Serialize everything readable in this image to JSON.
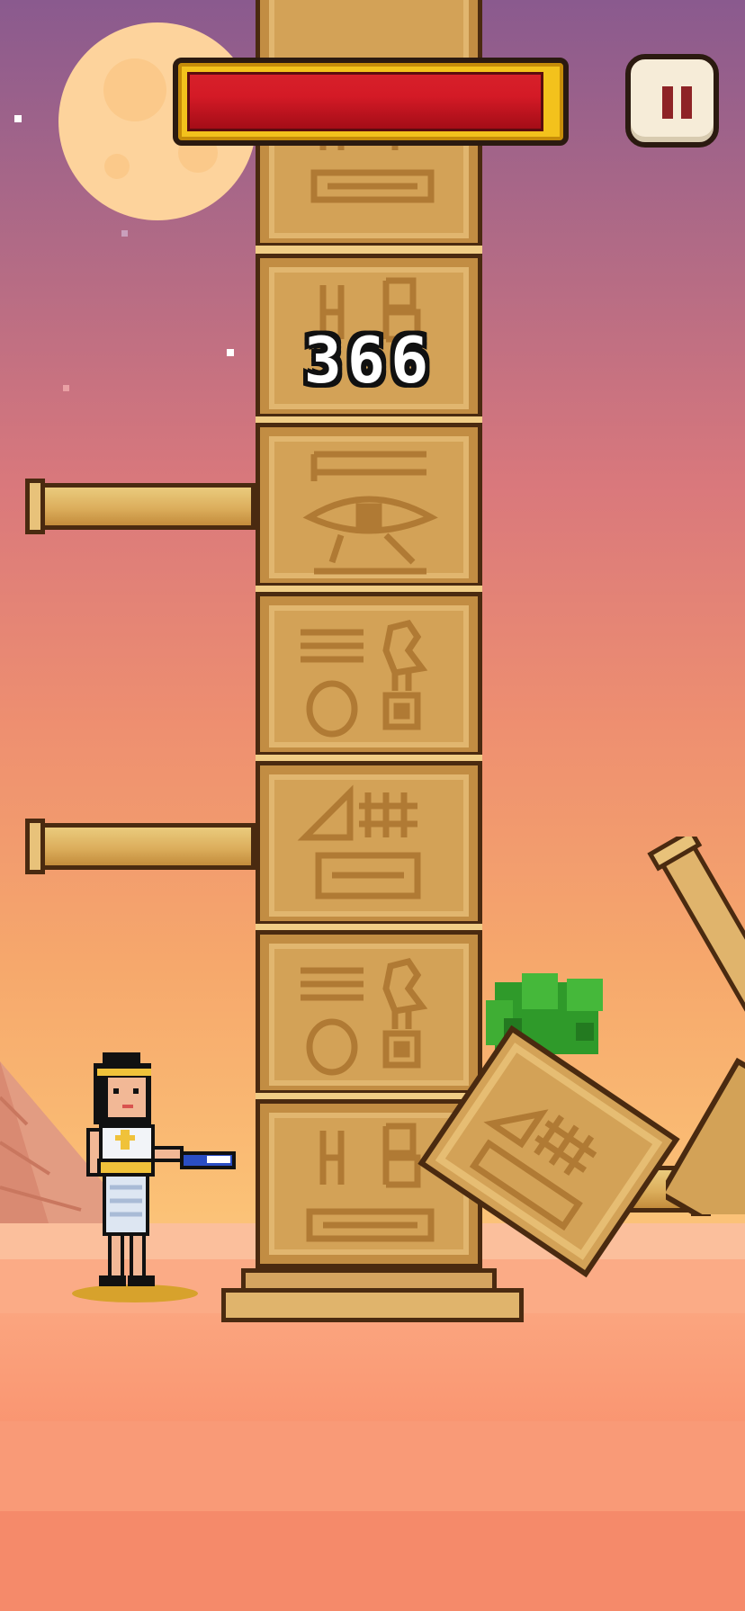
{
  "game": {
    "score": "366",
    "health_fraction": 0.97
  },
  "hud": {
    "pause_icon": "pause-icon"
  },
  "colors": {
    "health_red": "#c9101c",
    "health_gold": "#f3c21c",
    "pillar_sand": "#d3a257",
    "outline": "#4a2a10"
  },
  "pillar": {
    "blocks": [
      {
        "glyph": "hieroglyph-panel"
      },
      {
        "glyph": "hieroglyph-panel"
      },
      {
        "glyph": "hieroglyph-panel"
      },
      {
        "glyph": "eye-of-horus-panel"
      },
      {
        "glyph": "bird-panel"
      },
      {
        "glyph": "pyramid-panel"
      },
      {
        "glyph": "bird-panel"
      },
      {
        "glyph": "hieroglyph-panel"
      }
    ],
    "branches": [
      {
        "side": "left"
      },
      {
        "side": "left"
      }
    ]
  },
  "player": {
    "character": "pharaoh-queen"
  }
}
